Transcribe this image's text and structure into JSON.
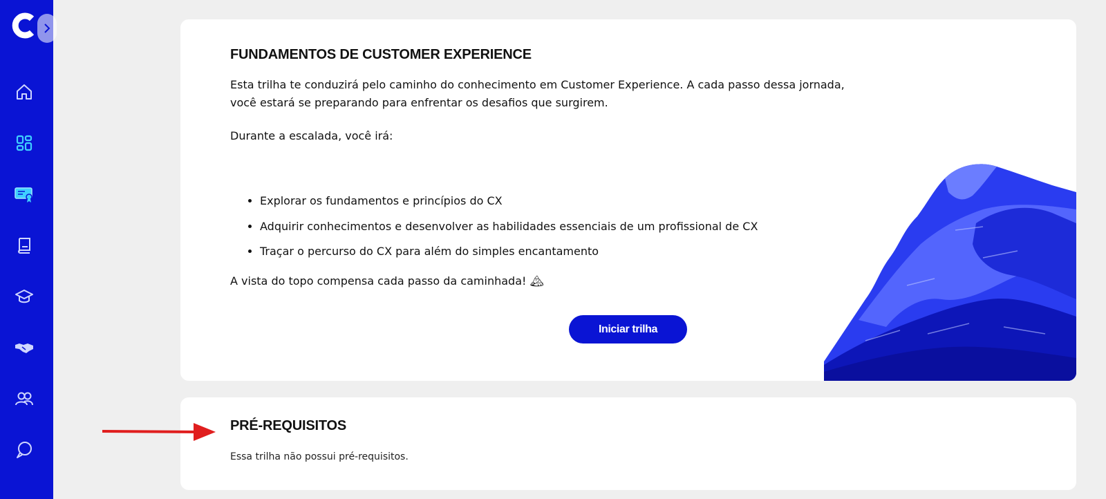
{
  "colors": {
    "sidebar": "#0a14d4",
    "accent": "#0a14d4",
    "active_icon": "#3fd0ff",
    "page_background": "#efefef",
    "annotation_arrow": "#e01e1e"
  },
  "sidebar": {
    "logo": "c-logo-icon",
    "expand_icon": "chevron-right-icon",
    "items": [
      {
        "icon": "home-icon"
      },
      {
        "icon": "dashboard-icon",
        "active": true
      },
      {
        "icon": "certificate-icon"
      },
      {
        "icon": "book-icon"
      },
      {
        "icon": "graduation-cap-icon"
      },
      {
        "icon": "handshake-icon"
      },
      {
        "icon": "users-icon"
      },
      {
        "icon": "chat-icon"
      }
    ]
  },
  "track": {
    "title": "FUNDAMENTOS DE CUSTOMER EXPERIENCE",
    "intro": "Esta trilha te conduzirá pelo caminho do conhecimento em Customer Experience. A cada passo dessa jornada, você estará se preparando para enfrentar os desafios que surgirem.",
    "lead": "Durante a escalada, você irá:",
    "goals": [
      "Explorar os fundamentos e princípios do CX",
      "Adquirir conhecimentos e desenvolver as habilidades essenciais de um profissional de CX",
      "Traçar o percurso do CX para além do simples encantamento"
    ],
    "closing": "A vista do topo compensa cada passo da caminhada! 🏔",
    "start_button": "Iniciar trilha",
    "illustration": "mountain-illustration"
  },
  "prerequisites": {
    "title": "PRÉ-REQUISITOS",
    "text": "Essa trilha não possui pré-requisitos."
  }
}
